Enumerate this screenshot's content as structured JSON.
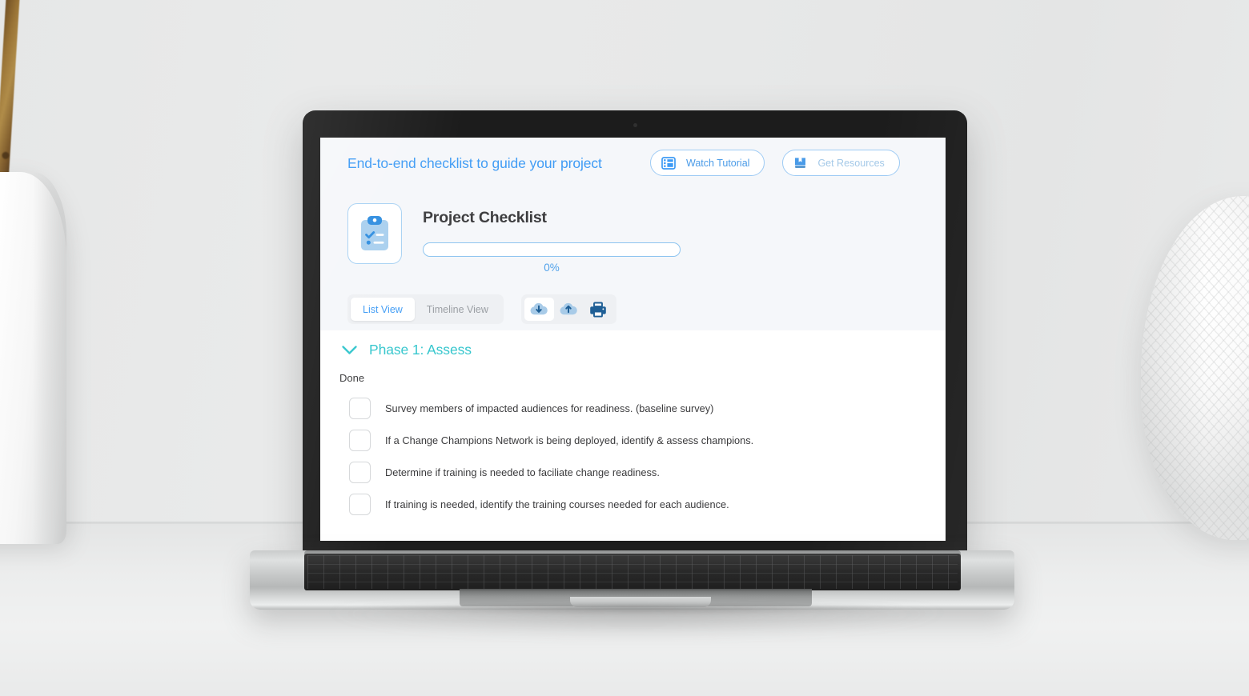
{
  "app": {
    "headline": "End-to-end checklist to guide your project",
    "top_actions": [
      {
        "label": "Watch Tutorial",
        "icon": "film-icon",
        "style": "primary"
      },
      {
        "label": "Get Resources",
        "icon": "bookmark-book-icon",
        "style": "muted"
      }
    ],
    "checklist": {
      "icon": "clipboard-checklist-icon",
      "title": "Project Checklist",
      "progress_percent_label": "0%",
      "progress_value": 0
    },
    "toolbar": {
      "views": [
        {
          "label": "List View",
          "active": true
        },
        {
          "label": "Timeline View",
          "active": false
        }
      ],
      "icon_buttons": [
        {
          "name": "cloud-download-icon"
        },
        {
          "name": "cloud-upload-icon"
        },
        {
          "name": "printer-icon"
        }
      ]
    },
    "phase": {
      "chevron": "chevron-down-icon",
      "title": "Phase 1: Assess",
      "column_header_done": "Done",
      "tasks": [
        {
          "text": "Survey members of impacted audiences for readiness. (baseline survey)",
          "checked": false
        },
        {
          "text": "If a Change Champions Network is being deployed, identify & assess champions.",
          "checked": false
        },
        {
          "text": "Determine if training is needed to faciliate change readiness.",
          "checked": false
        },
        {
          "text": "If training is needed, identify the training courses needed for each audience.",
          "checked": false
        }
      ]
    },
    "colors": {
      "accent_blue": "#3e9bf5",
      "muted_blue": "#a4c9e8",
      "teal": "#34c6cd",
      "header_bg": "#f5f7fa",
      "text_dark": "#3a3a3c",
      "icon_dark_blue": "#1f5f96",
      "icon_light_blue": "#a8cbe8"
    }
  }
}
